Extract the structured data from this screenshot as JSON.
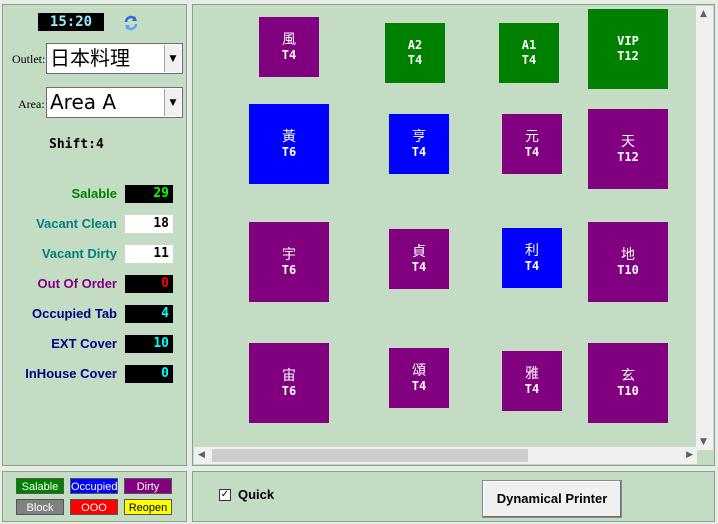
{
  "clock": "15:20",
  "outlet": {
    "label": "Outlet:",
    "value": "日本料理"
  },
  "area": {
    "label": "Area:",
    "value": "Area A"
  },
  "shift": "Shift:4",
  "stats": [
    {
      "name": "Salable",
      "value": "29",
      "name_color": "#008000",
      "val_bg": "#000000",
      "val_color": "#00ff00"
    },
    {
      "name": "Vacant Clean",
      "value": "18",
      "name_color": "#008080",
      "val_bg": "#ffffff",
      "val_color": "#000000"
    },
    {
      "name": "Vacant Dirty",
      "value": "11",
      "name_color": "#008080",
      "val_bg": "#ffffff",
      "val_color": "#000000"
    },
    {
      "name": "Out Of Order",
      "value": "0",
      "name_color": "#800080",
      "val_bg": "#000000",
      "val_color": "#ff0000"
    },
    {
      "name": "Occupied Tab",
      "value": "4",
      "name_color": "#000080",
      "val_bg": "#000000",
      "val_color": "#00ffff"
    },
    {
      "name": "EXT Cover",
      "value": "10",
      "name_color": "#000080",
      "val_bg": "#000000",
      "val_color": "#00ffff"
    },
    {
      "name": "InHouse Cover",
      "value": "0",
      "name_color": "#000080",
      "val_bg": "#000000",
      "val_color": "#00ffff"
    }
  ],
  "colors": {
    "salable": "#008000",
    "occupied": "#0000ff",
    "dirty": "#800080",
    "block": "#808080",
    "ooo": "#ff0000",
    "reopen": "#ffff00"
  },
  "tables": [
    {
      "name": "風",
      "code": "T4",
      "status": "dirty"
    },
    {
      "name": "A2",
      "code": "T4",
      "status": "salable"
    },
    {
      "name": "A1",
      "code": "T4",
      "status": "salable"
    },
    {
      "name": "VIP",
      "code": "T12",
      "status": "salable"
    },
    {
      "name": "黃",
      "code": "T6",
      "status": "occupied"
    },
    {
      "name": "亨",
      "code": "T4",
      "status": "occupied"
    },
    {
      "name": "元",
      "code": "T4",
      "status": "dirty"
    },
    {
      "name": "天",
      "code": "T12",
      "status": "dirty"
    },
    {
      "name": "宇",
      "code": "T6",
      "status": "dirty"
    },
    {
      "name": "貞",
      "code": "T4",
      "status": "dirty"
    },
    {
      "name": "利",
      "code": "T4",
      "status": "occupied"
    },
    {
      "name": "地",
      "code": "T10",
      "status": "dirty"
    },
    {
      "name": "宙",
      "code": "T6",
      "status": "dirty"
    },
    {
      "name": "頌",
      "code": "T4",
      "status": "dirty"
    },
    {
      "name": "雅",
      "code": "T4",
      "status": "dirty"
    },
    {
      "name": "玄",
      "code": "T10",
      "status": "dirty"
    }
  ],
  "legend": [
    {
      "label": "Salable",
      "status": "salable",
      "text_color": "#ffffff"
    },
    {
      "label": "Occupied",
      "status": "occupied",
      "text_color": "#ffffff"
    },
    {
      "label": "Dirty",
      "status": "dirty",
      "text_color": "#ffffff"
    },
    {
      "label": "Block",
      "status": "block",
      "text_color": "#ffffff"
    },
    {
      "label": "OOO",
      "status": "ooo",
      "text_color": "#ffffff"
    },
    {
      "label": "Reopen",
      "status": "reopen",
      "text_color": "#000000"
    }
  ],
  "quick": {
    "label": "Quick",
    "checked": true,
    "mark": "✓"
  },
  "printer_button": "Dynamical Printer"
}
